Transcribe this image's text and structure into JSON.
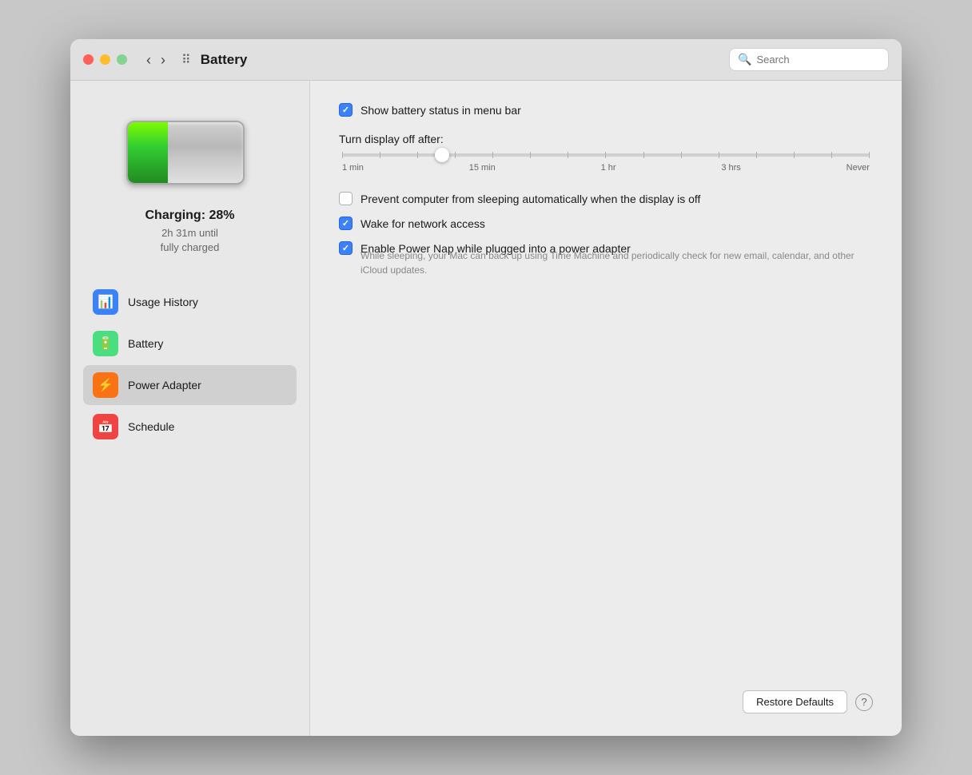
{
  "window": {
    "title": "Battery",
    "search_placeholder": "Search"
  },
  "titlebar": {
    "back_label": "‹",
    "forward_label": "›",
    "grid_icon": "⊞"
  },
  "sidebar": {
    "battery_status": {
      "charging_label": "Charging: 28%",
      "charging_sublabel": "2h 31m until\nfully charged"
    },
    "nav_items": [
      {
        "id": "usage-history",
        "label": "Usage History",
        "icon": "📊",
        "icon_class": "icon-blue",
        "active": false
      },
      {
        "id": "battery",
        "label": "Battery",
        "icon": "🔋",
        "icon_class": "icon-green",
        "active": false
      },
      {
        "id": "power-adapter",
        "label": "Power Adapter",
        "icon": "⚡",
        "icon_class": "icon-orange",
        "active": true
      },
      {
        "id": "schedule",
        "label": "Schedule",
        "icon": "📅",
        "icon_class": "icon-red",
        "active": false
      }
    ]
  },
  "main": {
    "show_battery_status_label": "Show battery status in menu bar",
    "show_battery_status_checked": true,
    "slider": {
      "title": "Turn display off after:",
      "labels": [
        "1 min",
        "15 min",
        "1 hr",
        "3 hrs",
        "Never"
      ],
      "position_percent": 19
    },
    "options": [
      {
        "id": "prevent-sleep",
        "label": "Prevent computer from sleeping automatically when the display is off",
        "checked": false,
        "desc": null
      },
      {
        "id": "wake-network",
        "label": "Wake for network access",
        "checked": true,
        "desc": null
      },
      {
        "id": "power-nap",
        "label": "Enable Power Nap while plugged into a power adapter",
        "checked": true,
        "desc": "While sleeping, your Mac can back up using Time Machine and periodically check for new email, calendar, and other iCloud updates."
      }
    ],
    "restore_defaults_label": "Restore Defaults",
    "help_label": "?"
  }
}
